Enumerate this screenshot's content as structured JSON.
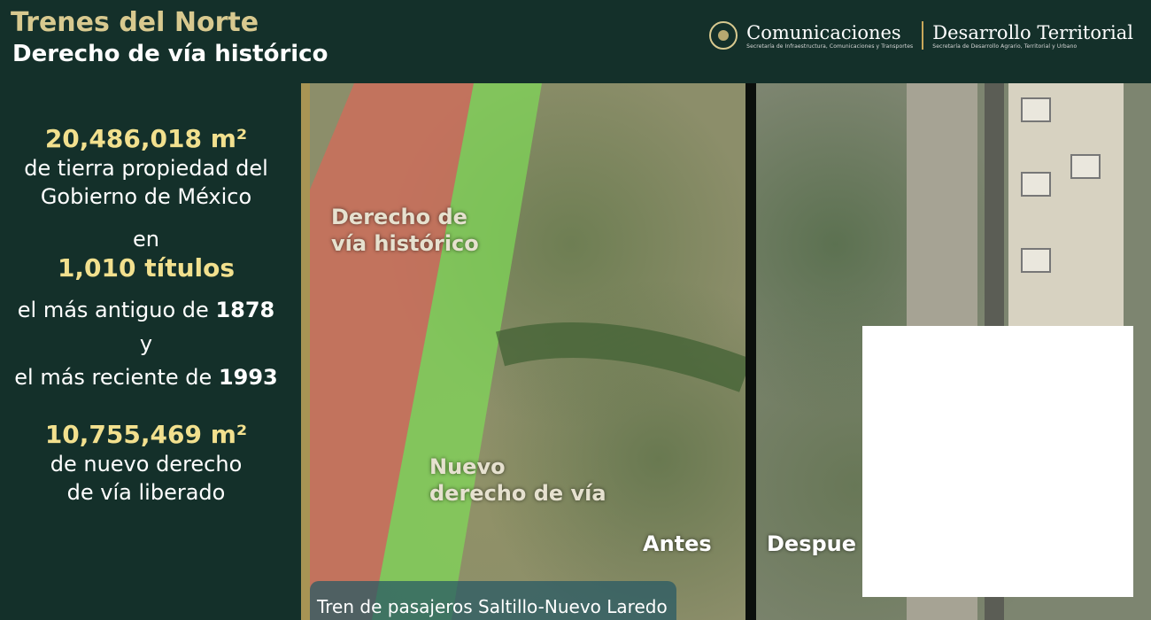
{
  "header": {
    "title": "Trenes del Norte",
    "subtitle": "Derecho de vía histórico",
    "logos": {
      "left": {
        "name": "Comunicaciones",
        "sub": "Secretaría de Infraestructura, Comunicaciones y Transportes"
      },
      "right": {
        "name": "Desarrollo Territorial",
        "sub": "Secretaría de Desarrollo Agrario, Territorial y Urbano"
      }
    }
  },
  "stats": {
    "area1": "20,486,018 m²",
    "area1_desc1": "de tierra propiedad del",
    "area1_desc2": "Gobierno de México",
    "en": "en",
    "titles": "1,010 títulos",
    "oldest_prefix": "el más antiguo de",
    "oldest_year": "1878",
    "y": "y",
    "newest_prefix": "el más reciente de",
    "newest_year": "1993",
    "area2": "10,755,469 m²",
    "area2_desc1": "de nuevo derecho",
    "area2_desc2": "de vía liberado"
  },
  "image": {
    "label_historic": "Derecho de\nvía histórico",
    "label_historic_1": "Derecho de",
    "label_historic_2": "vía histórico",
    "label_new_1": "Nuevo",
    "label_new_2": "derecho de vía",
    "before": "Antes",
    "after": "Despue",
    "caption": "Tren de pasajeros Saltillo-Nuevo Laredo"
  },
  "colors": {
    "background": "#14302a",
    "accent_gold": "#f2e08e",
    "historic_band": "#d46a5a",
    "new_band": "#7fdc57"
  }
}
